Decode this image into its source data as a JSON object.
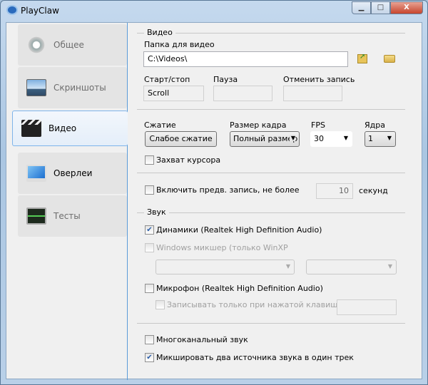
{
  "window": {
    "title": "PlayClaw"
  },
  "nav": [
    {
      "label": "Общее",
      "icon": "gear-icon"
    },
    {
      "label": "Скриншоты",
      "icon": "picture-icon"
    },
    {
      "label": "Видео",
      "icon": "clapperboard-icon",
      "selected": true
    },
    {
      "label": "Оверлеи",
      "icon": "monitor-icon"
    },
    {
      "label": "Тесты",
      "icon": "heartbeat-monitor-icon"
    }
  ],
  "video": {
    "group": "Видео",
    "folder_label": "Папка для видео",
    "folder_value": "C:\\Videos\\",
    "start_stop_label": "Старт/стоп",
    "start_stop_value": "Scroll",
    "pause_label": "Пауза",
    "pause_value": "",
    "cancel_label": "Отменить запись",
    "cancel_value": "",
    "compression_label": "Сжатие",
    "compression_button": "Слабое сжатие",
    "frame_size_label": "Размер кадра",
    "frame_size_value": "Полный размер",
    "fps_label": "FPS",
    "fps_value": "30",
    "cores_label": "Ядра",
    "cores_value": "1",
    "capture_cursor": "Захват курсора",
    "prerecord": "Включить предв. запись, не более",
    "prerecord_value": "10",
    "prerecord_unit": "секунд"
  },
  "sound": {
    "group": "Звук",
    "speakers": "Динамики (Realtek High Definition Audio)",
    "winmixer": "Windows микшер (только WinXP",
    "mic": "Микрофон (Realtek High Definition Audio)",
    "push_to_talk": "Записывать только при нажатой клавише",
    "multichannel": "Многоканальный звук",
    "mix_two": "Микшировать два источника звука в один трек"
  }
}
